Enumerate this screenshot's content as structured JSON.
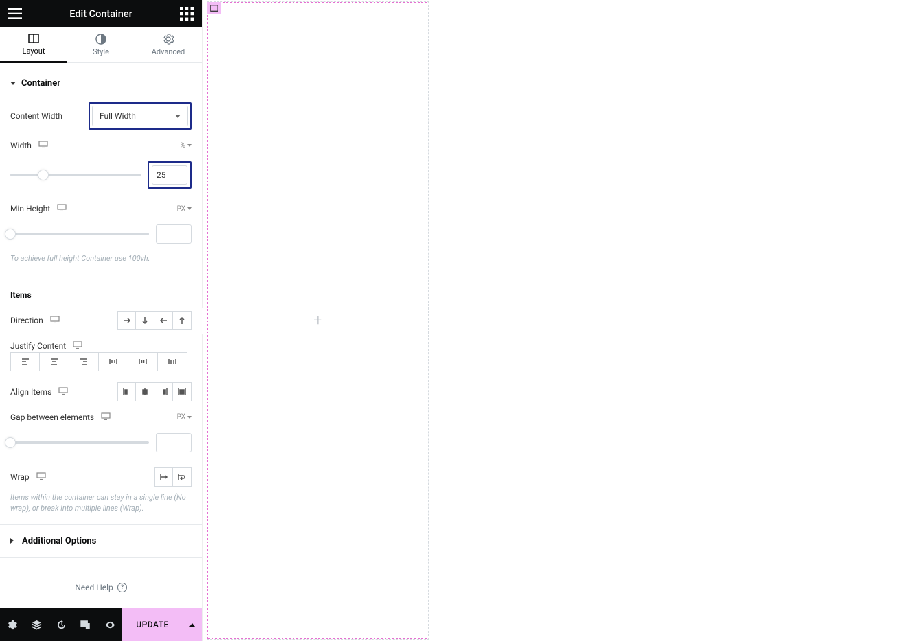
{
  "header": {
    "title": "Edit Container"
  },
  "tabs": [
    {
      "label": "Layout",
      "active": true
    },
    {
      "label": "Style",
      "active": false
    },
    {
      "label": "Advanced",
      "active": false
    }
  ],
  "sections": {
    "container": {
      "title": "Container",
      "content_width": {
        "label": "Content Width",
        "value": "Full Width"
      },
      "width": {
        "label": "Width",
        "unit": "%",
        "value": "25",
        "slider_pct": 25
      },
      "min_height": {
        "label": "Min Height",
        "unit": "PX",
        "value": "",
        "slider_pct": 0
      },
      "hint": "To achieve full height Container use 100vh."
    },
    "items": {
      "title": "Items",
      "direction": {
        "label": "Direction"
      },
      "justify": {
        "label": "Justify Content"
      },
      "align": {
        "label": "Align Items"
      },
      "gap": {
        "label": "Gap between elements",
        "unit": "PX",
        "value": "",
        "slider_pct": 0
      },
      "wrap": {
        "label": "Wrap"
      },
      "wrap_hint": "Items within the container can stay in a single line (No wrap), or break into multiple lines (Wrap)."
    },
    "additional": {
      "title": "Additional Options"
    }
  },
  "help": {
    "label": "Need Help"
  },
  "footer": {
    "update": "UPDATE"
  }
}
